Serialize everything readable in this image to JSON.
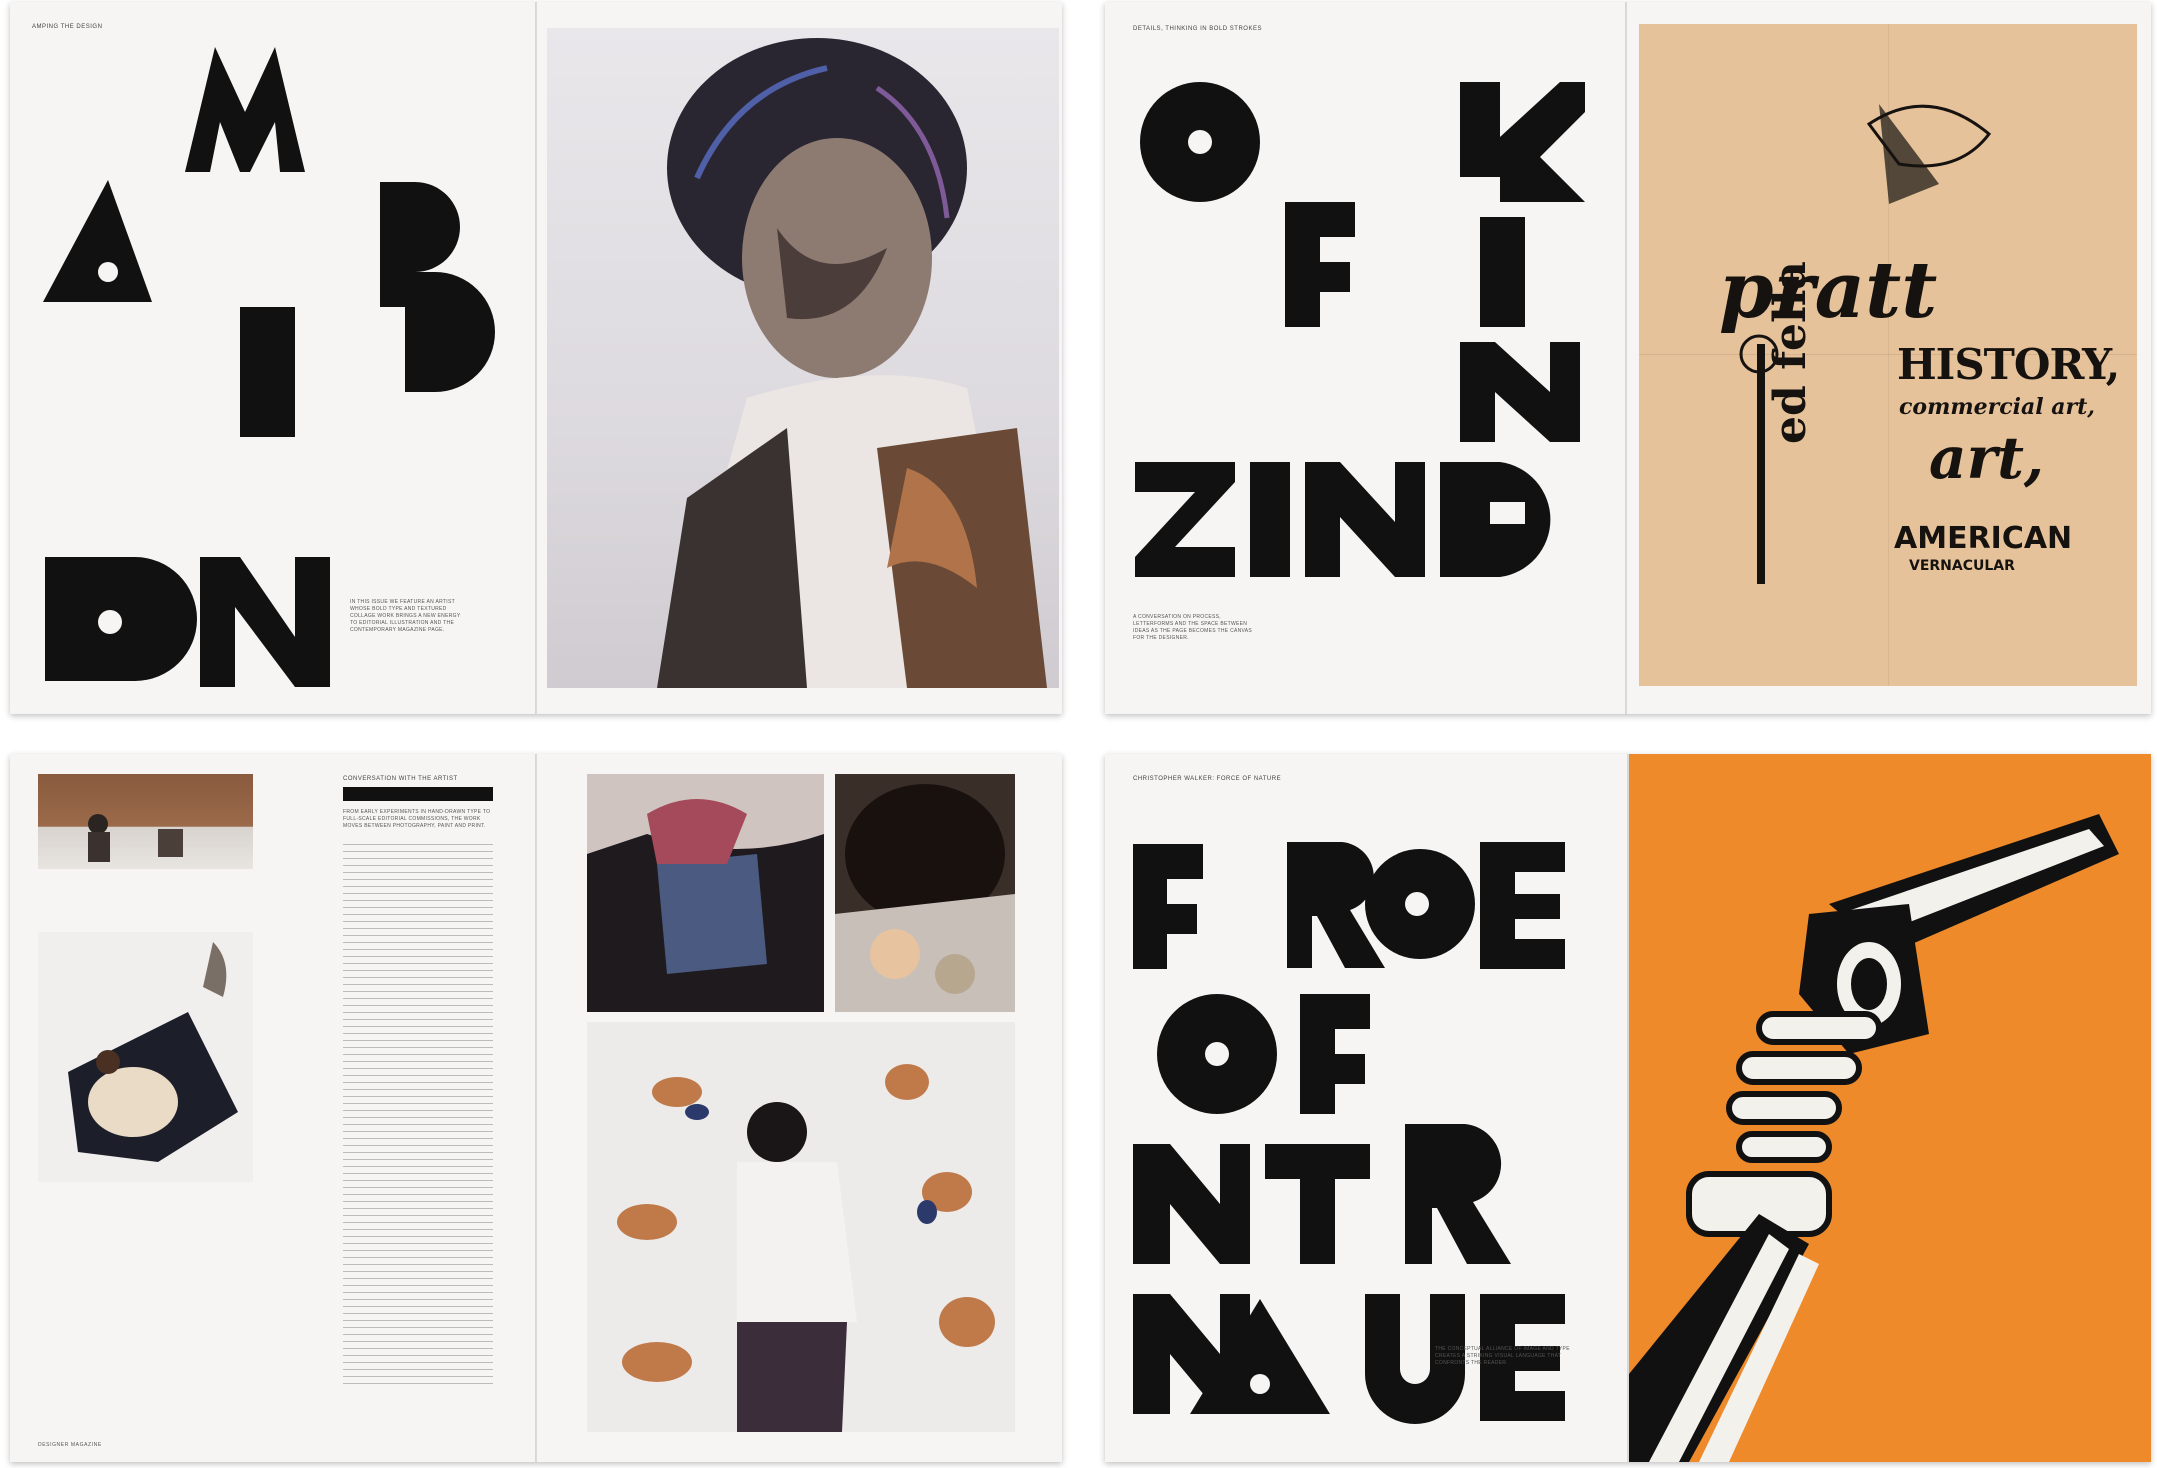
{
  "spreads": {
    "amp": {
      "kicker": "AMPING THE DESIGN",
      "letters": [
        "M",
        "A",
        "P",
        "I",
        "D",
        "O",
        "N"
      ],
      "body": "IN THIS ISSUE WE FEATURE AN ARTIST WHOSE BOLD TYPE AND TEXTURED COLLAGE WORK BRINGS A NEW ENERGY TO EDITORIAL ILLUSTRATION AND THE CONTEMPORARY MAGAZINE PAGE."
    },
    "thinking": {
      "kicker": "DETAILS, THINKING IN BOLD STROKES",
      "letters": [
        "O",
        "K",
        "F",
        "I",
        "N",
        "ZING"
      ],
      "body": "A CONVERSATION ON PROCESS, LETTERFORMS AND THE SPACE BETWEEN IDEAS AS THE PAGE BECOMES THE CANVAS FOR THE DESIGNER.",
      "poster": {
        "words": [
          "pratt",
          "HISTORY,",
          "commercial art,",
          "art,",
          "AMERICAN",
          "ed fella",
          "VERNACULAR"
        ],
        "bg": "#e5c29a"
      }
    },
    "interview": {
      "kicker": "CONVERSATION WITH THE ARTIST",
      "body": "FROM EARLY EXPERIMENTS IN HAND-DRAWN TYPE TO FULL-SCALE EDITORIAL COMMISSIONS, THE WORK MOVES BETWEEN PHOTOGRAPHY, PAINT AND PRINT.",
      "folio": "DESIGNER MAGAZINE"
    },
    "force": {
      "kicker": "CHRISTOPHER WALKER: FORCE OF NATURE",
      "letters": [
        "F",
        "ROE",
        "OF",
        "R",
        "N",
        "TR",
        "A",
        "UE"
      ],
      "body": "THE CONCEPTUAL ALLIANCE OF IMAGE AND TYPE CREATES A STRIKING VISUAL LANGUAGE THAT CONFRONTS THE READER.",
      "accent": "#ee8a2a"
    }
  }
}
